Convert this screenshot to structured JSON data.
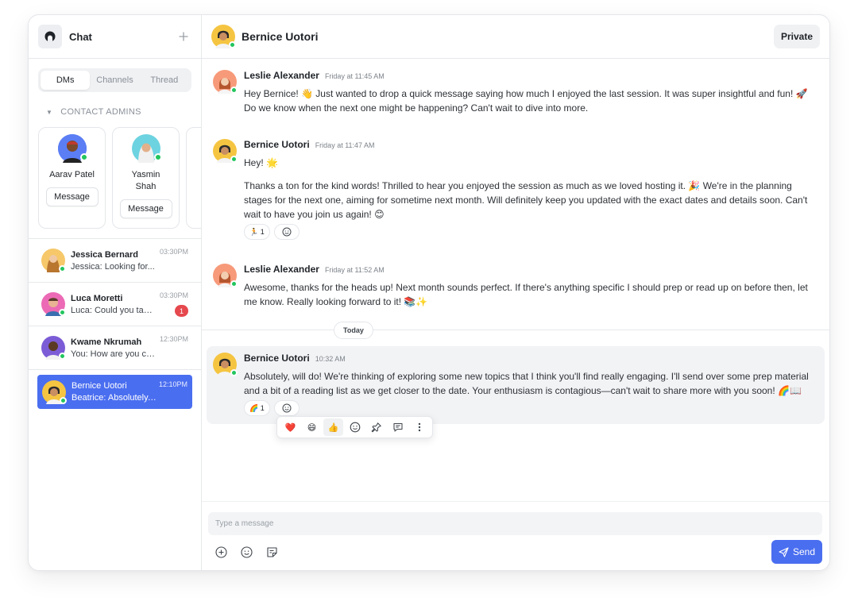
{
  "sidebar": {
    "title": "Chat",
    "tabs": [
      "DMs",
      "Channels",
      "Thread"
    ],
    "section_label": "CONTACT ADMINS",
    "admins": [
      {
        "name": "Aarav Patel",
        "button": "Message"
      },
      {
        "name": "Yasmin Shah",
        "button": "Message"
      }
    ],
    "dms": [
      {
        "name": "Jessica Bernard",
        "preview": "Jessica: Looking for...",
        "time": "03:30PM",
        "unread": ""
      },
      {
        "name": "Luca Moretti",
        "preview": "Luca: Could you take...",
        "time": "03:30PM",
        "unread": "1"
      },
      {
        "name": "Kwame Nkrumah",
        "preview": "You: How are you co...",
        "time": "12:30PM",
        "unread": ""
      },
      {
        "name": "Bernice Uotori",
        "preview": "Beatrice: Absolutely,...",
        "time": "12:10PM",
        "unread": ""
      }
    ]
  },
  "header": {
    "title": "Bernice Uotori",
    "private_label": "Private"
  },
  "messages": [
    {
      "author": "Leslie Alexander",
      "time": "Friday at 11:45 AM",
      "text": [
        "Hey Bernice! 👋 Just wanted to drop a quick message saying how much I enjoyed the last session. It was super insightful and fun! 🚀 Do we know when the next one might be happening? Can't wait to dive into more."
      ]
    },
    {
      "author": "Bernice Uotori",
      "time": "Friday at 11:47 AM",
      "text": [
        "Hey! 🌟",
        "Thanks a ton for the kind words! Thrilled to hear you enjoyed the session as much as we loved hosting it. 🎉 We're in the planning stages for the next one, aiming for sometime next month. Will definitely keep you updated with the exact dates and details soon. Can't wait to have you join us again! 😊"
      ],
      "reaction": {
        "emoji": "🏃",
        "count": "1"
      }
    },
    {
      "author": "Leslie Alexander",
      "time": "Friday at 11:52 AM",
      "text": [
        "Awesome, thanks for the heads up! Next month sounds perfect. If there's anything specific I should prep or read up on before then, let me know. Really looking forward to it! 📚✨"
      ]
    },
    {
      "author": "Bernice Uotori",
      "time": "10:32 AM",
      "text": [
        "Absolutely, will do! We're thinking of exploring some new topics that I think you'll find really engaging. I'll send over some prep material and a bit of a reading list as we get closer to the date. Your enthusiasm is contagious—can't wait to share more with you soon! 🌈📖"
      ],
      "reaction": {
        "emoji": "🌈",
        "count": "1"
      }
    }
  ],
  "day_divider": "Today",
  "hover_bar": {
    "emojis": [
      "❤️",
      "😄",
      "👍"
    ]
  },
  "composer": {
    "placeholder": "Type a message",
    "send_label": "Send"
  },
  "colors": {
    "accent": "#4a6ef0",
    "online": "#22c55e",
    "unread": "#e5484d"
  }
}
